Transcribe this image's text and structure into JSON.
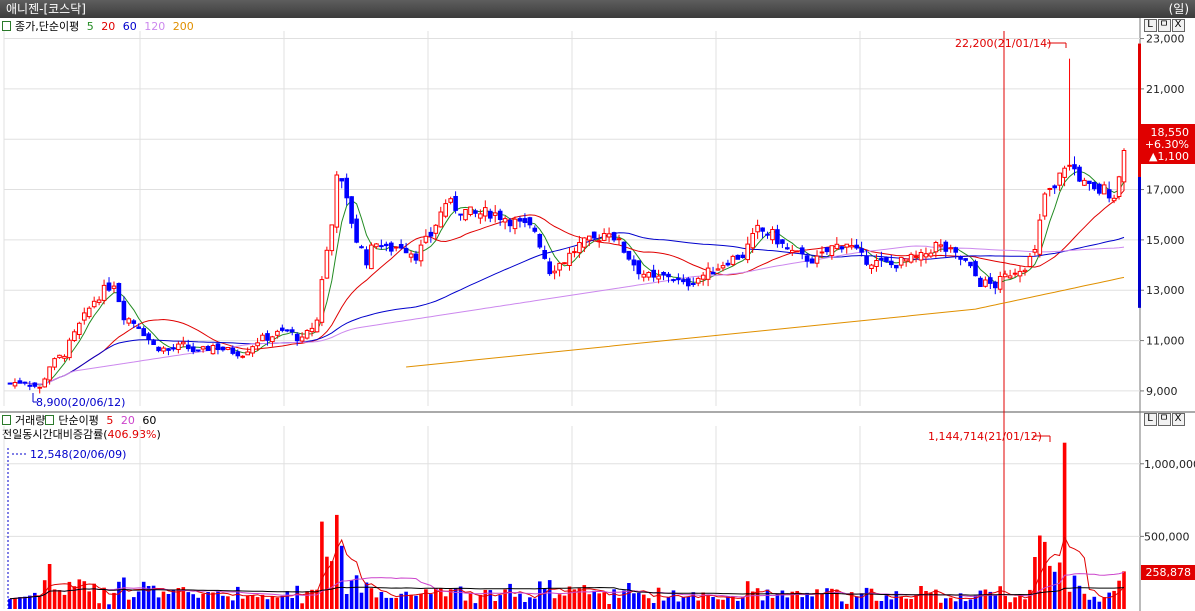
{
  "window": {
    "title": "애니젠-[코스닥]",
    "period": "(일)"
  },
  "price_pane": {
    "legend_title": "종가,단순이평",
    "ma_labels": [
      {
        "label": "5",
        "color": "#228b22"
      },
      {
        "label": "20",
        "color": "#e00000"
      },
      {
        "label": "60",
        "color": "#0000cc"
      },
      {
        "label": "120",
        "color": "#cc88ee"
      },
      {
        "label": "200",
        "color": "#e09000"
      }
    ],
    "high_annotation": "22,200(21/01/14)",
    "low_annotation": "8,900(20/06/12)",
    "current": {
      "price": "18,550",
      "change_pct": "+6.30%",
      "change_amt": "▲1,100"
    },
    "pane_buttons": [
      "L",
      "ㅁ",
      "X"
    ]
  },
  "volume_pane": {
    "legend_title": "거래량",
    "legend_ma_title": "단순이평",
    "ma_labels": [
      {
        "label": "5",
        "color": "#e00000"
      },
      {
        "label": "20",
        "color": "#cc44cc"
      },
      {
        "label": "60",
        "color": "#000000"
      }
    ],
    "subtitle": "전일동시간대비증감률(",
    "subtitle_value": "406.93%",
    "subtitle_close": ")",
    "max_annotation": "1,144,714(21/01/12)",
    "min_annotation": "12,548(20/06/09)",
    "current_volume": "258,878",
    "pane_buttons": [
      "L",
      "ㅁ",
      "X"
    ]
  },
  "colors": {
    "up": "#ff0000",
    "down": "#0000ff",
    "ma5": "#228b22",
    "ma20": "#e00000",
    "ma60": "#0000cc",
    "ma120": "#cc88ee",
    "ma200": "#e09000"
  },
  "chart_data": [
    {
      "type": "candlestick",
      "y_ticks": [
        "23,000",
        "21,000",
        "19,000",
        "17,000",
        "15,000",
        "13,000",
        "11,000",
        "9,000"
      ],
      "y_tick_values": [
        23000,
        21000,
        19000,
        17000,
        15000,
        13000,
        11000,
        9000
      ],
      "ylim": [
        8400,
        23300
      ],
      "grid": true,
      "close_keypoints": [
        [
          0,
          9300
        ],
        [
          3,
          9400
        ],
        [
          6,
          9100
        ],
        [
          8,
          10000
        ],
        [
          11,
          10500
        ],
        [
          14,
          11600
        ],
        [
          17,
          12600
        ],
        [
          19,
          13000
        ],
        [
          21,
          13300
        ],
        [
          23,
          12000
        ],
        [
          26,
          11600
        ],
        [
          29,
          10800
        ],
        [
          32,
          10600
        ],
        [
          35,
          10800
        ],
        [
          38,
          10500
        ],
        [
          41,
          10800
        ],
        [
          44,
          10600
        ],
        [
          47,
          10500
        ],
        [
          50,
          11000
        ],
        [
          53,
          11200
        ],
        [
          56,
          11400
        ],
        [
          59,
          11000
        ],
        [
          62,
          11800
        ],
        [
          63,
          13500
        ],
        [
          65,
          15600
        ],
        [
          66,
          17800
        ],
        [
          68,
          16500
        ],
        [
          70,
          15000
        ],
        [
          72,
          14200
        ],
        [
          74,
          15000
        ],
        [
          76,
          14600
        ],
        [
          79,
          14800
        ],
        [
          82,
          14400
        ],
        [
          85,
          15200
        ],
        [
          88,
          16500
        ],
        [
          91,
          16200
        ],
        [
          94,
          16000
        ],
        [
          97,
          16100
        ],
        [
          100,
          15900
        ],
        [
          103,
          15600
        ],
        [
          106,
          15400
        ],
        [
          109,
          13800
        ],
        [
          112,
          14200
        ],
        [
          115,
          14800
        ],
        [
          118,
          15000
        ],
        [
          121,
          15400
        ],
        [
          124,
          14600
        ],
        [
          127,
          13800
        ],
        [
          130,
          13400
        ],
        [
          133,
          13600
        ],
        [
          136,
          13200
        ],
        [
          139,
          13500
        ],
        [
          142,
          13800
        ],
        [
          145,
          14200
        ],
        [
          148,
          14400
        ],
        [
          151,
          15400
        ],
        [
          154,
          15200
        ],
        [
          157,
          14600
        ],
        [
          160,
          14300
        ],
        [
          163,
          14200
        ],
        [
          166,
          14700
        ],
        [
          169,
          14900
        ],
        [
          172,
          14300
        ],
        [
          175,
          14100
        ],
        [
          178,
          14000
        ],
        [
          181,
          14200
        ],
        [
          184,
          14300
        ],
        [
          187,
          14800
        ],
        [
          190,
          14500
        ],
        [
          193,
          14100
        ],
        [
          196,
          13300
        ],
        [
          199,
          13200
        ],
        [
          202,
          13700
        ],
        [
          205,
          14000
        ],
        [
          207,
          14500
        ],
        [
          209,
          16800
        ],
        [
          211,
          17000
        ],
        [
          213,
          18000
        ],
        [
          215,
          17800
        ],
        [
          217,
          17200
        ],
        [
          219,
          16900
        ],
        [
          221,
          17000
        ],
        [
          223,
          16800
        ],
        [
          224,
          17450
        ],
        [
          225,
          18550
        ]
      ],
      "high": {
        "date": "21/01/14",
        "value": 22200
      },
      "low": {
        "date": "20/06/12",
        "value": 8900
      },
      "last_close": 18550
    },
    {
      "type": "bar",
      "series_name": "거래량",
      "y_ticks": [
        "1,000,000",
        "500,000"
      ],
      "y_tick_values": [
        1000000,
        500000
      ],
      "ylim": [
        0,
        1260000
      ],
      "max": {
        "date": "21/01/12",
        "value": 1144714
      },
      "min": {
        "date": "20/06/09",
        "value": 12548
      },
      "last_value": 258878
    }
  ]
}
